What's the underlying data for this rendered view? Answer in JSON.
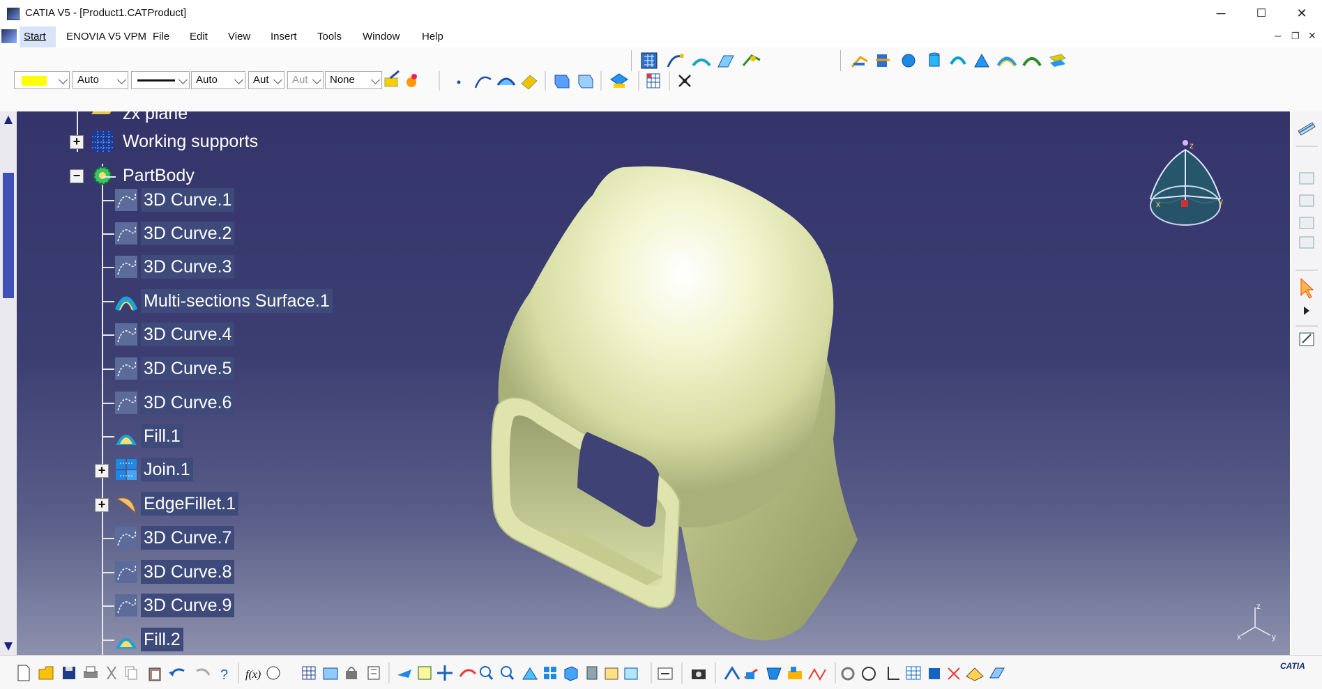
{
  "window": {
    "title": "CATIA V5 - [Product1.CATProduct]",
    "minimize": "─",
    "maximize": "☐",
    "close": "✕"
  },
  "menu": {
    "items": [
      "Start",
      "ENOVIA V5 VPM",
      "File",
      "Edit",
      "View",
      "Insert",
      "Tools",
      "Window",
      "Help"
    ]
  },
  "toolbar": {
    "color_swatch": "#ffff00",
    "transparency": "Auto",
    "line_weight": "Auto",
    "line_type_value": "Aut",
    "layer_value": "Aut",
    "layer_filter": "None"
  },
  "tree": {
    "partial_top": "zx plane",
    "working_supports": "Working supports",
    "partbody": "PartBody",
    "items": [
      "3D Curve.1",
      "3D Curve.2",
      "3D Curve.3",
      "Multi-sections Surface.1",
      "3D Curve.4",
      "3D Curve.5",
      "3D Curve.6",
      "Fill.1",
      "Join.1",
      "EdgeFillet.1",
      "3D Curve.7",
      "3D Curve.8",
      "3D Curve.9",
      "Fill.2"
    ]
  },
  "compass": {
    "z": "z",
    "x": "x",
    "y": "y"
  },
  "axis_triad": {
    "z": "z",
    "x": "x",
    "y": "y"
  },
  "brand": "CATIA",
  "colors": {
    "viewport_top": "#34346a",
    "viewport_bottom": "#8d91ad",
    "selection": "#3d4a7a",
    "part": "#e9edb6"
  }
}
